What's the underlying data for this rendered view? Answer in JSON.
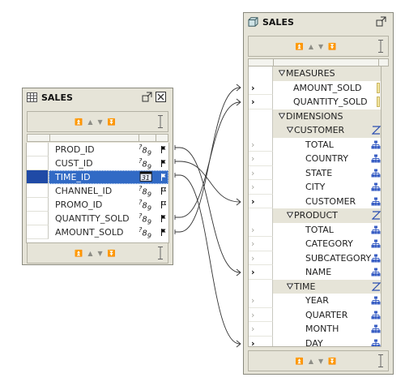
{
  "left_panel": {
    "title": "SALES",
    "columns": [
      {
        "name": "PROD_ID",
        "type_icon": "numeric-type-icon",
        "type_glyph": "?89",
        "flag": "solid"
      },
      {
        "name": "CUST_ID",
        "type_icon": "numeric-type-icon",
        "type_glyph": "?89",
        "flag": "solid"
      },
      {
        "name": "TIME_ID",
        "type_icon": "date-type-icon",
        "type_glyph": "31",
        "flag": "solid",
        "selected": true
      },
      {
        "name": "CHANNEL_ID",
        "type_icon": "numeric-type-icon",
        "type_glyph": "?89",
        "flag": "outline"
      },
      {
        "name": "PROMO_ID",
        "type_icon": "numeric-type-icon",
        "type_glyph": "?89",
        "flag": "outline"
      },
      {
        "name": "QUANTITY_SOLD",
        "type_icon": "numeric-type-icon",
        "type_glyph": "?89",
        "flag": "solid"
      },
      {
        "name": "AMOUNT_SOLD",
        "type_icon": "numeric-type-icon",
        "type_glyph": "?89",
        "flag": "solid"
      }
    ]
  },
  "right_panel": {
    "title": "SALES",
    "rows": [
      {
        "kind": "group",
        "level": 0,
        "label": "MEASURES"
      },
      {
        "kind": "leaf",
        "label": "AMOUNT_SOLD",
        "chevron": "bold",
        "icon": "measure-icon"
      },
      {
        "kind": "leaf",
        "label": "QUANTITY_SOLD",
        "chevron": "bold",
        "icon": "measure-icon"
      },
      {
        "kind": "group",
        "level": 0,
        "label": "DIMENSIONS"
      },
      {
        "kind": "group",
        "level": 1,
        "label": "CUSTOMER",
        "icon": "hierarchy-toggle-icon"
      },
      {
        "kind": "leaf",
        "label": "TOTAL",
        "chevron": "light",
        "icon": "level-icon"
      },
      {
        "kind": "leaf",
        "label": "COUNTRY",
        "chevron": "light",
        "icon": "level-icon"
      },
      {
        "kind": "leaf",
        "label": "STATE",
        "chevron": "light",
        "icon": "level-icon"
      },
      {
        "kind": "leaf",
        "label": "CITY",
        "chevron": "light",
        "icon": "level-icon"
      },
      {
        "kind": "leaf",
        "label": "CUSTOMER",
        "chevron": "bold",
        "icon": "level-icon"
      },
      {
        "kind": "group",
        "level": 1,
        "label": "PRODUCT",
        "icon": "hierarchy-toggle-icon"
      },
      {
        "kind": "leaf",
        "label": "TOTAL",
        "chevron": "light",
        "icon": "level-icon"
      },
      {
        "kind": "leaf",
        "label": "CATEGORY",
        "chevron": "light",
        "icon": "level-icon"
      },
      {
        "kind": "leaf",
        "label": "SUBCATEGORY",
        "chevron": "light",
        "icon": "level-icon"
      },
      {
        "kind": "leaf",
        "label": "NAME",
        "chevron": "bold",
        "icon": "level-icon"
      },
      {
        "kind": "group",
        "level": 1,
        "label": "TIME",
        "icon": "hierarchy-toggle-icon"
      },
      {
        "kind": "leaf",
        "label": "YEAR",
        "chevron": "light",
        "icon": "level-icon"
      },
      {
        "kind": "leaf",
        "label": "QUARTER",
        "chevron": "light",
        "icon": "level-icon"
      },
      {
        "kind": "leaf",
        "label": "MONTH",
        "chevron": "light",
        "icon": "level-icon"
      },
      {
        "kind": "leaf",
        "label": "DAY",
        "chevron": "bold",
        "icon": "level-icon"
      }
    ]
  },
  "mappings": [
    {
      "from": "PROD_ID",
      "to": "PRODUCT.NAME"
    },
    {
      "from": "CUST_ID",
      "to": "CUSTOMER.CUSTOMER"
    },
    {
      "from": "TIME_ID",
      "to": "TIME.DAY"
    },
    {
      "from": "QUANTITY_SOLD",
      "to": "MEASURES.QUANTITY_SOLD"
    },
    {
      "from": "AMOUNT_SOLD",
      "to": "MEASURES.AMOUNT_SOLD"
    }
  ],
  "colors": {
    "panel": "#e6e4d8",
    "selection": "#316ac5",
    "level_icon": "#3a5fc4"
  }
}
